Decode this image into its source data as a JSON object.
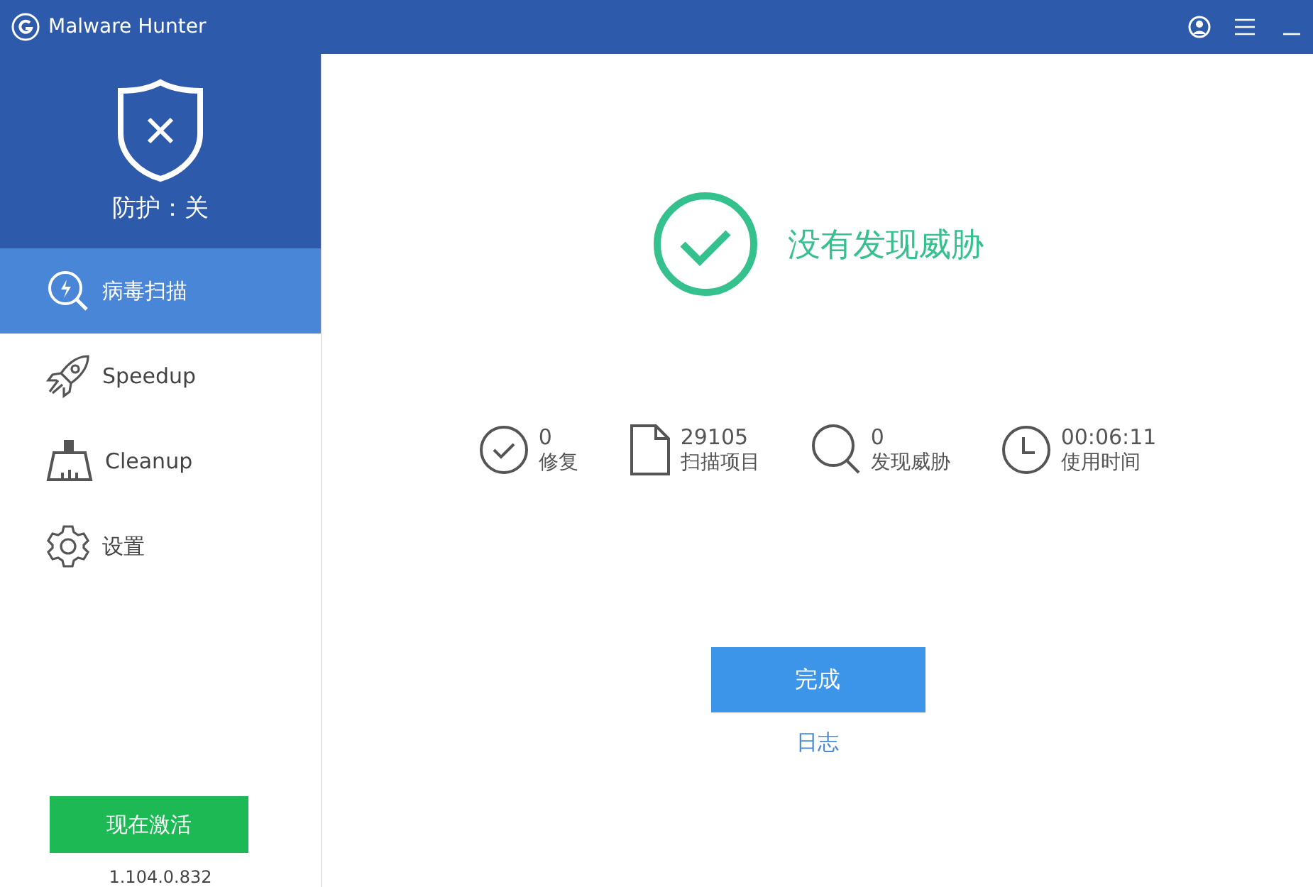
{
  "window": {
    "title": "Malware Hunter"
  },
  "protection": {
    "label": "防护：关",
    "on": false
  },
  "sidebar": {
    "items": [
      {
        "kind": "scan",
        "label": "病毒扫描",
        "selected": true
      },
      {
        "kind": "speedup",
        "label": "Speedup",
        "selected": false
      },
      {
        "kind": "cleanup",
        "label": "Cleanup",
        "selected": false
      },
      {
        "kind": "settings",
        "label": "设置",
        "selected": false
      }
    ],
    "activate_button": "现在激活",
    "version": "1.104.0.832"
  },
  "result": {
    "message": "没有发现威胁"
  },
  "stats": [
    {
      "kind": "fixed",
      "value": "0",
      "label": "修复"
    },
    {
      "kind": "scanned",
      "value": "29105",
      "label": "扫描项目"
    },
    {
      "kind": "found",
      "value": "0",
      "label": "发现威胁"
    },
    {
      "kind": "time",
      "value": "00:06:11",
      "label": "使用时间"
    }
  ],
  "done_button": "完成",
  "log_link": "日志"
}
